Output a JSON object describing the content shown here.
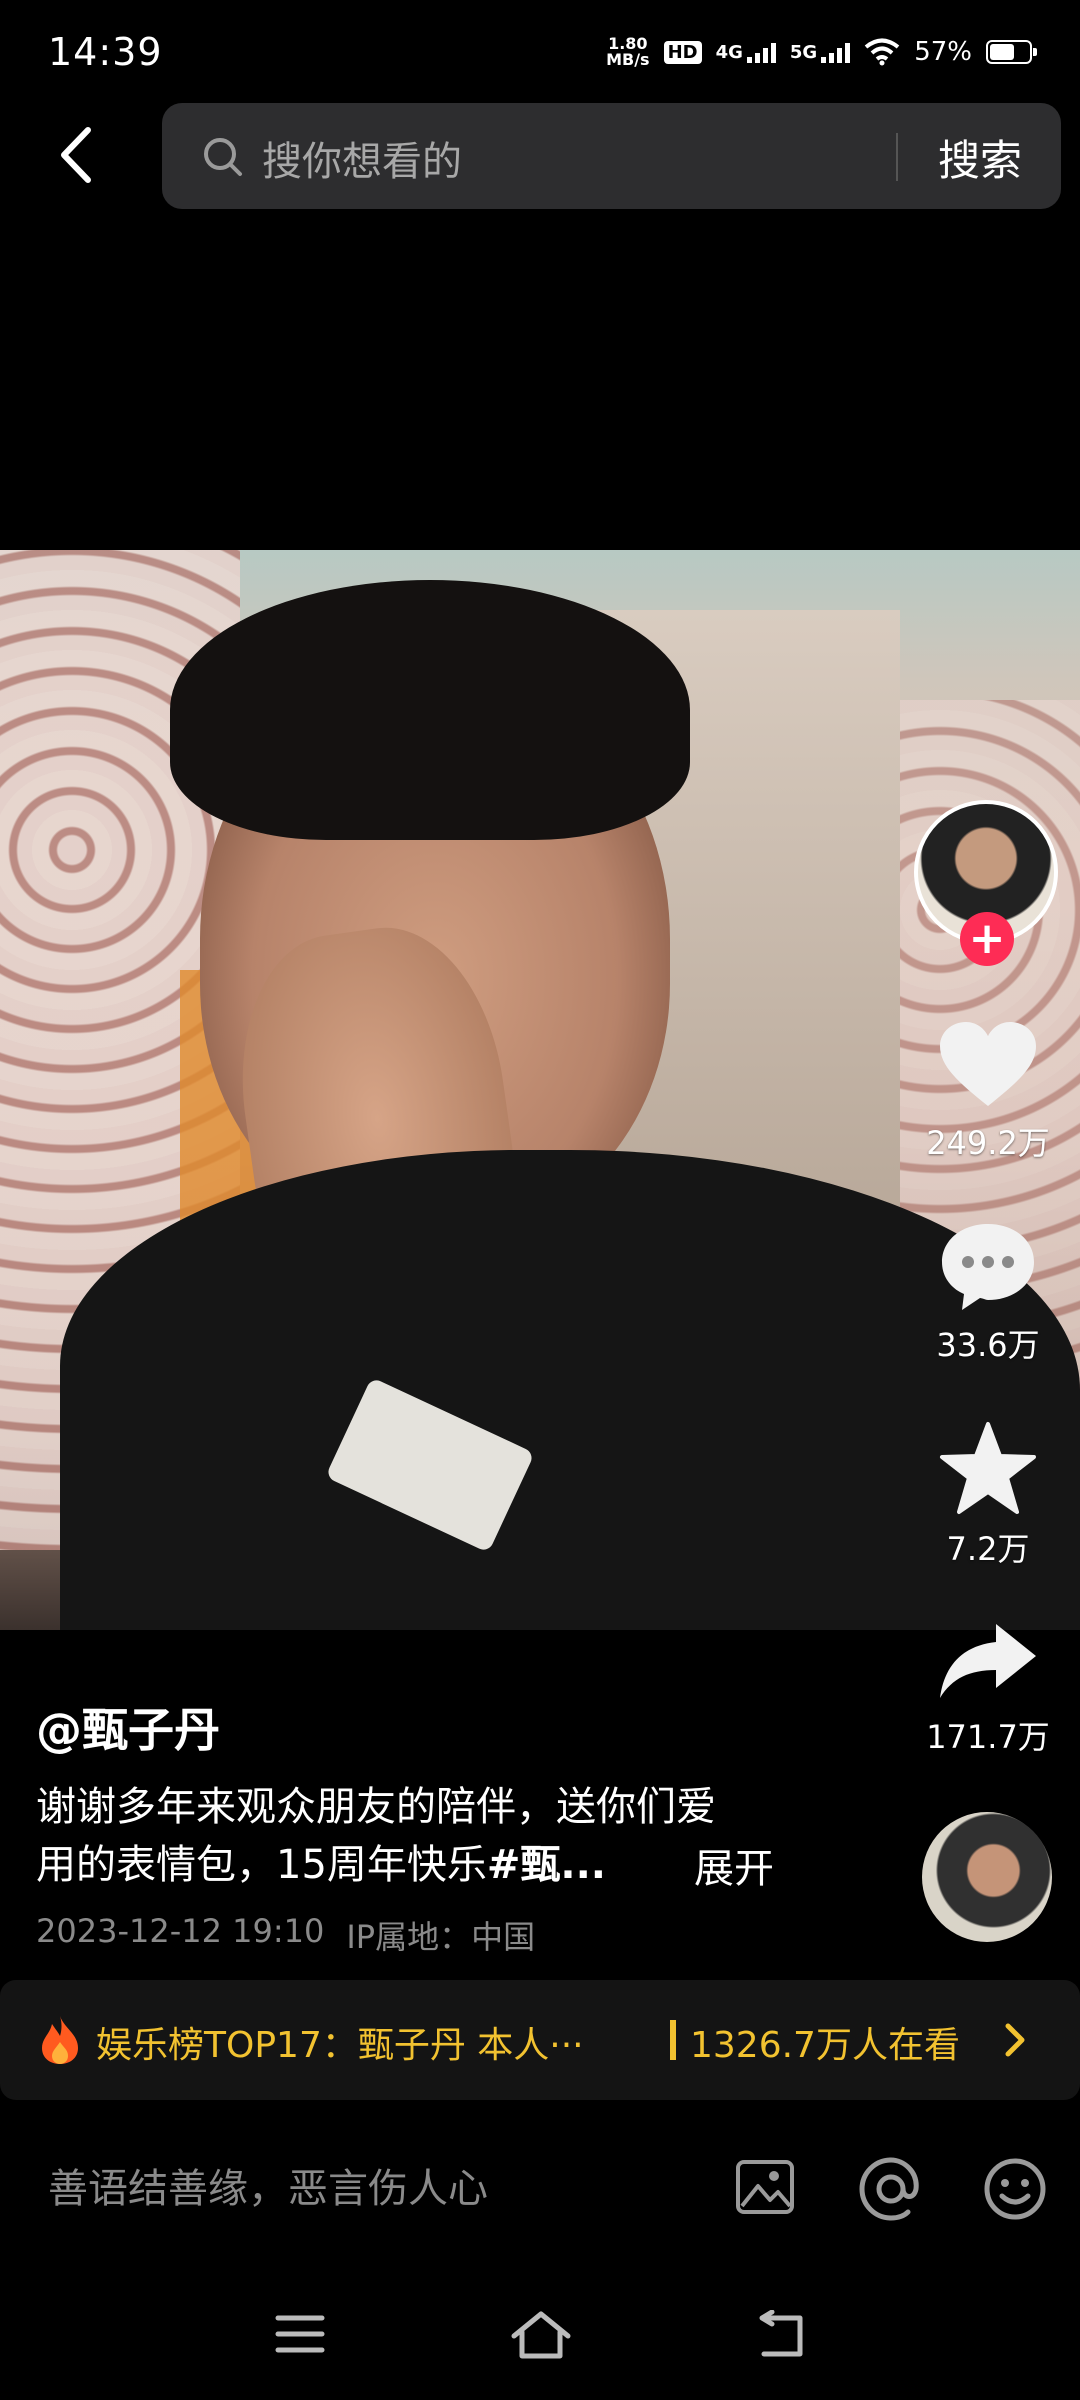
{
  "status_bar": {
    "time": "14:39",
    "net_speed_top": "1.80",
    "net_speed_bottom": "MB/s",
    "hd": "HD",
    "net1": "4G",
    "net2": "5G",
    "battery": "57%"
  },
  "search": {
    "placeholder": "搜你想看的",
    "button": "搜索"
  },
  "actions": {
    "likes": "249.2万",
    "comments": "33.6万",
    "favorites": "7.2万",
    "shares": "171.7万",
    "follow_symbol": "+"
  },
  "post": {
    "author": "@甄子丹",
    "description_line1": "谢谢多年来观众朋友的陪伴，送你们爱",
    "description_line2": "用的表情包，15周年快乐",
    "hashtag": "#甄...",
    "expand": "展开",
    "datetime": "2023-12-12 19:10",
    "ip_location": "IP属地：中国"
  },
  "hot_banner": {
    "title": "娱乐榜TOP17：甄子丹 本人···",
    "viewers": "1326.7万人在看"
  },
  "comment_input": {
    "placeholder": "善语结善缘，恶言伤人心"
  },
  "colors": {
    "accent_red": "#fe2c55",
    "hot_yellow": "#f2c230",
    "background": "#000000"
  }
}
